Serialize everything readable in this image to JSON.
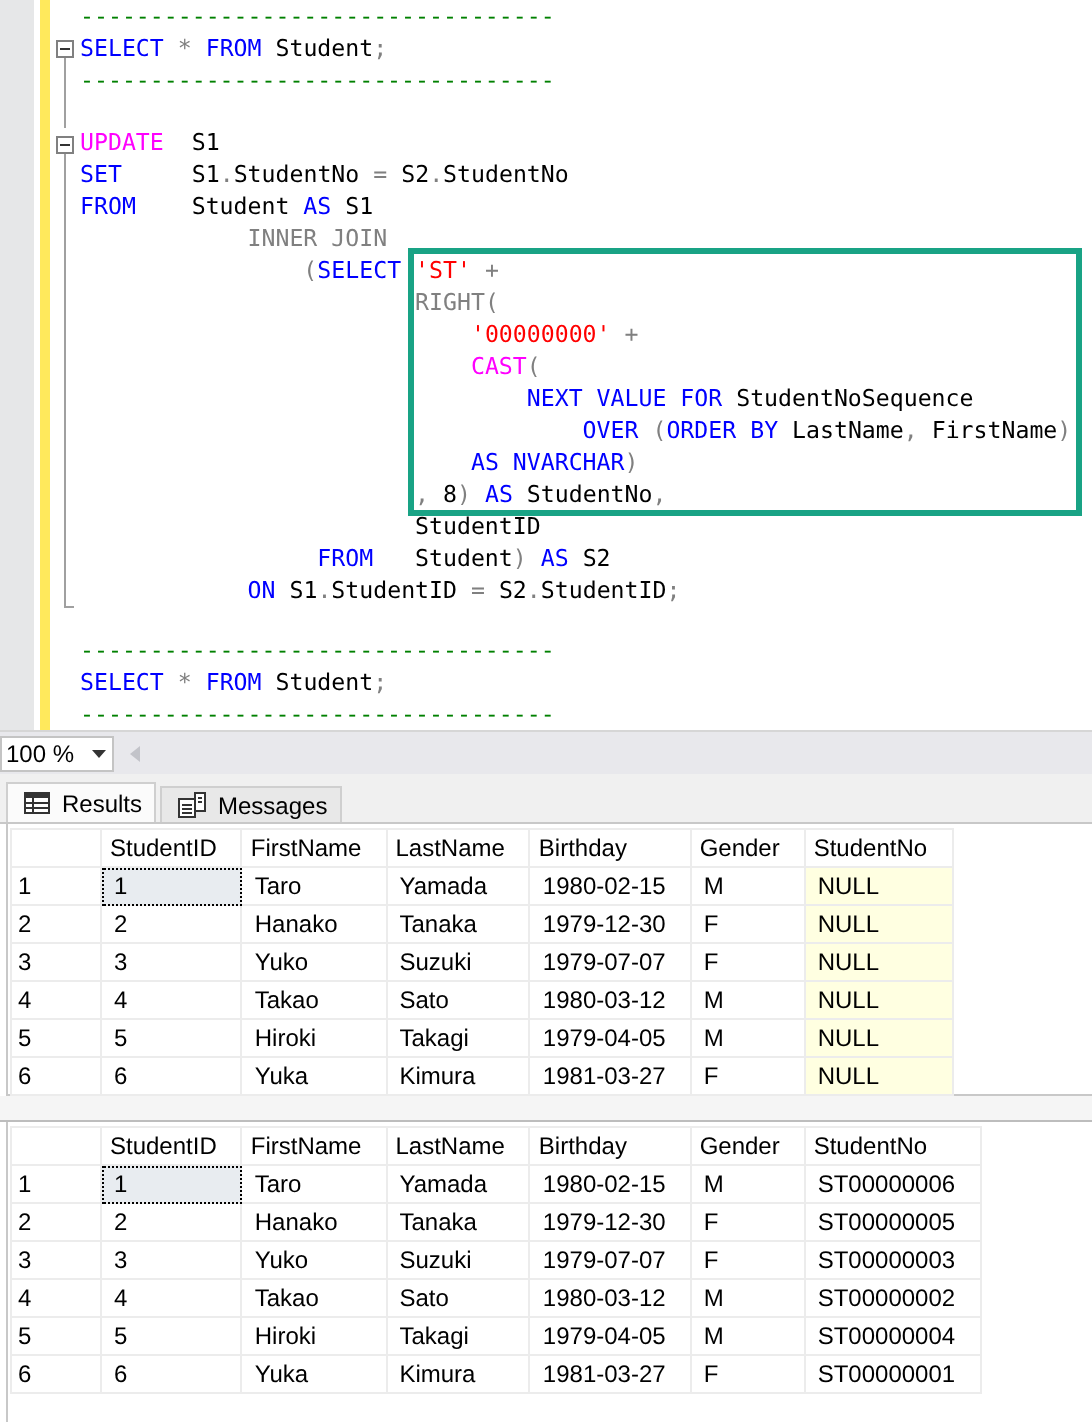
{
  "editor": {
    "lines": [
      {
        "kind": "line",
        "collapsible": false,
        "tokens": [
          {
            "text": "----------------------------------",
            "kind": "comment"
          }
        ]
      },
      {
        "kind": "line",
        "collapsible": true,
        "tokens": [
          {
            "text": "SELECT",
            "kind": "keyword"
          },
          {
            "text": " *",
            "kind": "operator"
          },
          {
            "text": " FROM",
            "kind": "keyword"
          },
          {
            "text": " Student",
            "kind": "plain"
          },
          {
            "text": ";",
            "kind": "operator"
          }
        ]
      },
      {
        "kind": "line",
        "collapsible": false,
        "fold_end": false,
        "tokens": [
          {
            "text": "----------------------------------",
            "kind": "comment"
          }
        ]
      },
      {
        "kind": "line",
        "collapsible": false,
        "fold_end": false
      },
      {
        "kind": "line",
        "collapsible": true,
        "tokens": [
          {
            "text": "UPDATE",
            "kind": "function"
          },
          {
            "text": "  S1",
            "kind": "plain"
          }
        ]
      },
      {
        "kind": "line",
        "collapsible": false,
        "fold_end": false,
        "tokens": [
          {
            "text": "SET",
            "kind": "keyword"
          },
          {
            "text": "     S1",
            "kind": "plain"
          },
          {
            "text": ".",
            "kind": "operator"
          },
          {
            "text": "StudentNo",
            "kind": "plain"
          },
          {
            "text": " =",
            "kind": "operator"
          },
          {
            "text": " S2",
            "kind": "plain"
          },
          {
            "text": ".",
            "kind": "operator"
          },
          {
            "text": "StudentNo",
            "kind": "plain"
          }
        ]
      },
      {
        "kind": "line",
        "collapsible": false,
        "fold_end": false,
        "tokens": [
          {
            "text": "FROM",
            "kind": "keyword"
          },
          {
            "text": "    Student",
            "kind": "plain"
          },
          {
            "text": " AS",
            "kind": "keyword"
          },
          {
            "text": " S1",
            "kind": "plain"
          }
        ]
      },
      {
        "kind": "line",
        "collapsible": false,
        "fold_end": false,
        "tokens": [
          {
            "text": "            INNER JOIN",
            "kind": "operator"
          }
        ]
      },
      {
        "kind": "highlight_block",
        "lead": [
          {
            "text": "                (",
            "kind": "operator"
          },
          {
            "text": "SELECT",
            "kind": "keyword"
          }
        ],
        "lines": [
          {
            "collapsible": false,
            "fold_end": false,
            "tokens": [
              {
                "text": "'ST'",
                "kind": "string"
              },
              {
                "text": " +",
                "kind": "operator"
              }
            ]
          },
          {
            "collapsible": false,
            "fold_end": false,
            "tokens": [
              {
                "text": "RIGHT(",
                "kind": "operator"
              }
            ]
          },
          {
            "collapsible": false,
            "fold_end": false,
            "tokens": [
              {
                "text": "    '00000000'",
                "kind": "string"
              },
              {
                "text": " +",
                "kind": "operator"
              }
            ]
          },
          {
            "collapsible": false,
            "fold_end": false,
            "tokens": [
              {
                "text": "    CAST",
                "kind": "function"
              },
              {
                "text": "(",
                "kind": "operator"
              }
            ]
          },
          {
            "collapsible": false,
            "fold_end": false,
            "tokens": [
              {
                "text": "        NEXT VALUE FOR",
                "kind": "keyword"
              },
              {
                "text": " StudentNoSequence",
                "kind": "plain"
              }
            ]
          },
          {
            "collapsible": false,
            "fold_end": false,
            "tokens": [
              {
                "text": "            OVER",
                "kind": "keyword"
              },
              {
                "text": " (",
                "kind": "operator"
              },
              {
                "text": "ORDER BY",
                "kind": "keyword"
              },
              {
                "text": " LastName",
                "kind": "plain"
              },
              {
                "text": ",",
                "kind": "operator"
              },
              {
                "text": " FirstName",
                "kind": "plain"
              },
              {
                "text": ")",
                "kind": "operator"
              }
            ]
          },
          {
            "collapsible": false,
            "fold_end": false,
            "tokens": [
              {
                "text": "    AS NVARCHAR",
                "kind": "keyword"
              },
              {
                "text": ")",
                "kind": "operator"
              }
            ]
          },
          {
            "collapsible": false,
            "fold_end": false,
            "tokens": [
              {
                "text": ",",
                "kind": "operator"
              },
              {
                "text": " 8",
                "kind": "plain"
              },
              {
                "text": ")",
                "kind": "operator"
              },
              {
                "text": " AS",
                "kind": "keyword"
              },
              {
                "text": " StudentNo",
                "kind": "plain"
              },
              {
                "text": ",",
                "kind": "operator"
              }
            ]
          }
        ]
      },
      {
        "kind": "line",
        "collapsible": false,
        "fold_end": false,
        "tokens": [
          {
            "text": "                        StudentID",
            "kind": "plain"
          }
        ]
      },
      {
        "kind": "line",
        "collapsible": false,
        "fold_end": false,
        "tokens": [
          {
            "text": "                 FROM",
            "kind": "keyword"
          },
          {
            "text": "   Student",
            "kind": "plain"
          },
          {
            "text": ")",
            "kind": "operator"
          },
          {
            "text": " AS",
            "kind": "keyword"
          },
          {
            "text": " S2",
            "kind": "plain"
          }
        ]
      },
      {
        "kind": "line",
        "collapsible": false,
        "fold_end": true,
        "tokens": [
          {
            "text": "            ON",
            "kind": "keyword"
          },
          {
            "text": " S1",
            "kind": "plain"
          },
          {
            "text": ".",
            "kind": "operator"
          },
          {
            "text": "StudentID",
            "kind": "plain"
          },
          {
            "text": " =",
            "kind": "operator"
          },
          {
            "text": " S2",
            "kind": "plain"
          },
          {
            "text": ".",
            "kind": "operator"
          },
          {
            "text": "StudentID",
            "kind": "plain"
          },
          {
            "text": ";",
            "kind": "operator"
          }
        ]
      },
      {
        "kind": "line"
      },
      {
        "kind": "line",
        "collapsible": false,
        "tokens": [
          {
            "text": "----------------------------------",
            "kind": "comment"
          }
        ]
      },
      {
        "kind": "line",
        "collapsible": false,
        "tokens": [
          {
            "text": "SELECT",
            "kind": "keyword"
          },
          {
            "text": " *",
            "kind": "operator"
          },
          {
            "text": " FROM",
            "kind": "keyword"
          },
          {
            "text": " Student",
            "kind": "plain"
          },
          {
            "text": ";",
            "kind": "operator"
          }
        ]
      },
      {
        "kind": "line",
        "collapsible": false,
        "tokens": [
          {
            "text": "----------------------------------",
            "kind": "comment"
          }
        ]
      }
    ]
  },
  "zoom": {
    "value": "100 %"
  },
  "tabs": [
    {
      "label": "Results",
      "kind": "results",
      "selected": true
    },
    {
      "label": "Messages",
      "kind": "messages",
      "selected": false
    }
  ],
  "grids": [
    {
      "columns": [
        {
          "label": "StudentID",
          "null_values": false
        },
        {
          "label": "FirstName",
          "null_values": false
        },
        {
          "label": "LastName",
          "null_values": false
        },
        {
          "label": "Birthday",
          "null_values": false
        },
        {
          "label": "Gender",
          "null_values": false
        },
        {
          "label": "StudentNo",
          "null_values": true
        }
      ],
      "rows": [
        {
          "number": "1",
          "focused": true,
          "cells": [
            "1",
            "Taro",
            "Yamada",
            "1980-02-15",
            "M",
            "NULL"
          ]
        },
        {
          "number": "2",
          "focused": false,
          "cells": [
            "2",
            "Hanako",
            "Tanaka",
            "1979-12-30",
            "F",
            "NULL"
          ]
        },
        {
          "number": "3",
          "focused": false,
          "cells": [
            "3",
            "Yuko",
            "Suzuki",
            "1979-07-07",
            "F",
            "NULL"
          ]
        },
        {
          "number": "4",
          "focused": false,
          "cells": [
            "4",
            "Takao",
            "Sato",
            "1980-03-12",
            "M",
            "NULL"
          ]
        },
        {
          "number": "5",
          "focused": false,
          "cells": [
            "5",
            "Hiroki",
            "Takagi",
            "1979-04-05",
            "M",
            "NULL"
          ]
        },
        {
          "number": "6",
          "focused": false,
          "cells": [
            "6",
            "Yuka",
            "Kimura",
            "1981-03-27",
            "F",
            "NULL"
          ]
        }
      ]
    },
    {
      "columns": [
        {
          "label": "StudentID",
          "null_values": false
        },
        {
          "label": "FirstName",
          "null_values": false
        },
        {
          "label": "LastName",
          "null_values": false
        },
        {
          "label": "Birthday",
          "null_values": false
        },
        {
          "label": "Gender",
          "null_values": false
        },
        {
          "label": "StudentNo",
          "null_values": false
        }
      ],
      "rows": [
        {
          "number": "1",
          "focused": true,
          "cells": [
            "1",
            "Taro",
            "Yamada",
            "1980-02-15",
            "M",
            "ST00000006"
          ]
        },
        {
          "number": "2",
          "focused": false,
          "cells": [
            "2",
            "Hanako",
            "Tanaka",
            "1979-12-30",
            "F",
            "ST00000005"
          ]
        },
        {
          "number": "3",
          "focused": false,
          "cells": [
            "3",
            "Yuko",
            "Suzuki",
            "1979-07-07",
            "F",
            "ST00000003"
          ]
        },
        {
          "number": "4",
          "focused": false,
          "cells": [
            "4",
            "Takao",
            "Sato",
            "1980-03-12",
            "M",
            "ST00000002"
          ]
        },
        {
          "number": "5",
          "focused": false,
          "cells": [
            "5",
            "Hiroki",
            "Takagi",
            "1979-04-05",
            "M",
            "ST00000004"
          ]
        },
        {
          "number": "6",
          "focused": false,
          "cells": [
            "6",
            "Yuka",
            "Kimura",
            "1981-03-27",
            "F",
            "ST00000001"
          ]
        }
      ]
    }
  ]
}
